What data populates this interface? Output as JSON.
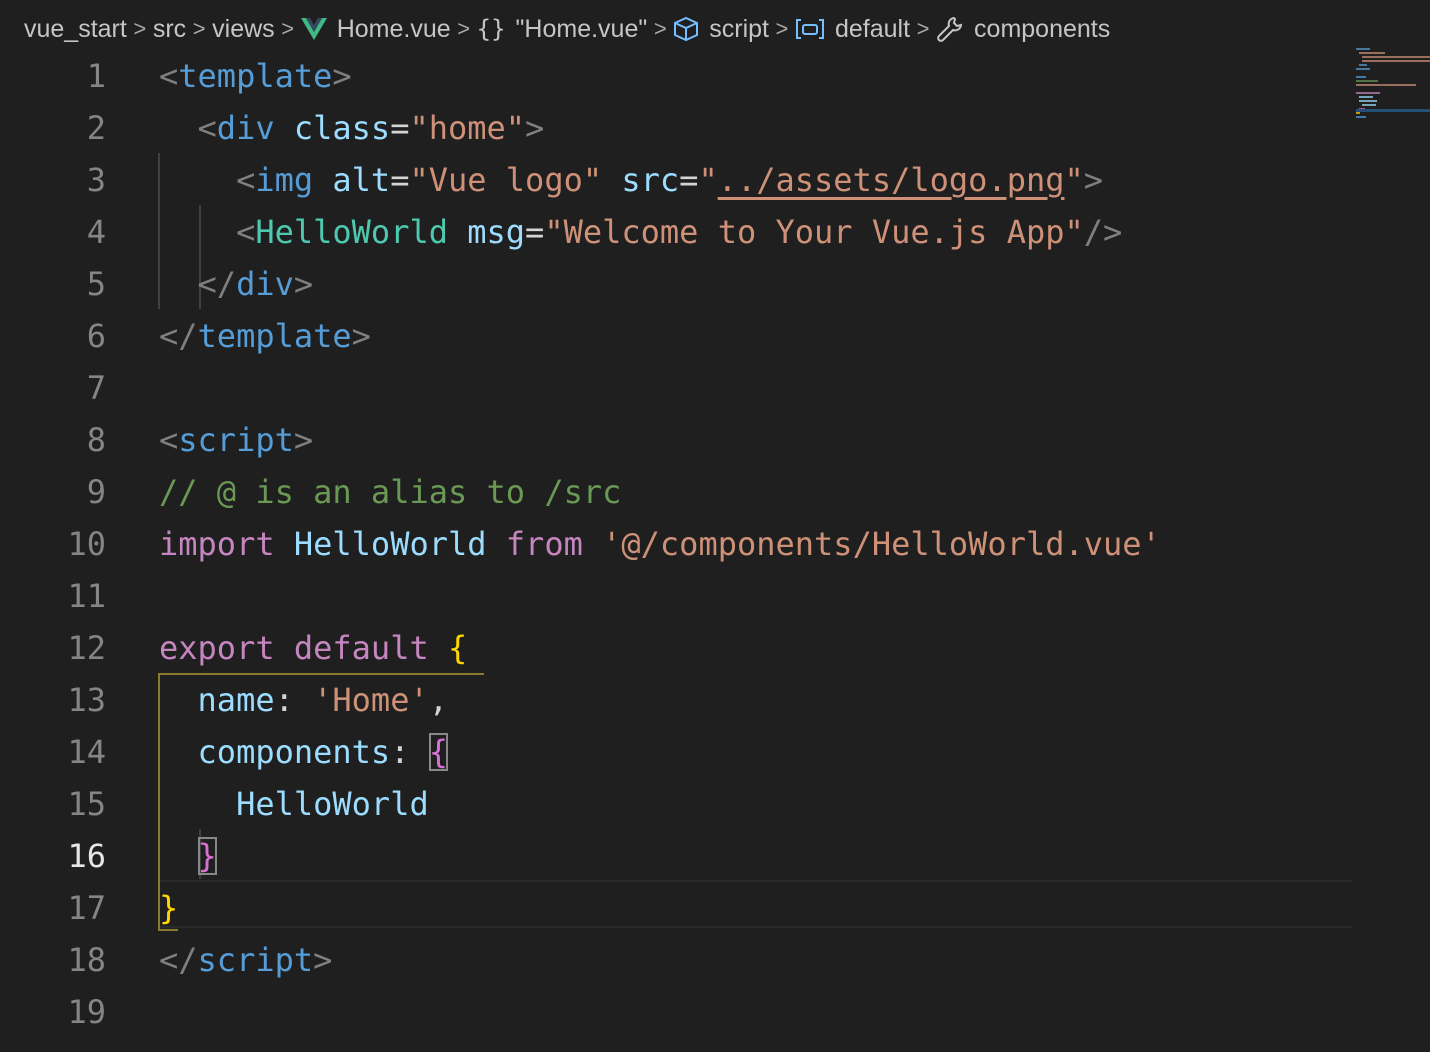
{
  "breadcrumb": {
    "items": [
      {
        "label": "vue_start",
        "icon": ""
      },
      {
        "label": "src",
        "icon": ""
      },
      {
        "label": "views",
        "icon": ""
      },
      {
        "label": "Home.vue",
        "icon": "vue-logo-icon"
      },
      {
        "label": "\"Home.vue\"",
        "icon": "braces-icon"
      },
      {
        "label": "script",
        "icon": "cube-icon"
      },
      {
        "label": "default",
        "icon": "variable-icon"
      },
      {
        "label": "components",
        "icon": "wrench-icon"
      }
    ],
    "separator": ">"
  },
  "editor": {
    "active_line": 16,
    "lines": [
      {
        "n": "1",
        "tokens": [
          [
            "punct",
            "<"
          ],
          [
            "tag",
            "template"
          ],
          [
            "punct",
            ">"
          ]
        ]
      },
      {
        "n": "2",
        "tokens": [
          [
            "text",
            "  "
          ],
          [
            "punct",
            "<"
          ],
          [
            "tag",
            "div"
          ],
          [
            "text",
            " "
          ],
          [
            "attr",
            "class"
          ],
          [
            "text",
            "="
          ],
          [
            "str",
            "\"home\""
          ],
          [
            "punct",
            ">"
          ]
        ]
      },
      {
        "n": "3",
        "tokens": [
          [
            "text",
            "    "
          ],
          [
            "punct",
            "<"
          ],
          [
            "tag",
            "img"
          ],
          [
            "text",
            " "
          ],
          [
            "attr",
            "alt"
          ],
          [
            "text",
            "="
          ],
          [
            "str",
            "\"Vue logo\""
          ],
          [
            "text",
            " "
          ],
          [
            "attr",
            "src"
          ],
          [
            "text",
            "="
          ],
          [
            "str",
            "\""
          ],
          [
            "strul",
            "../assets/logo.png"
          ],
          [
            "str",
            "\""
          ],
          [
            "punct",
            ">"
          ]
        ]
      },
      {
        "n": "4",
        "tokens": [
          [
            "text",
            "    "
          ],
          [
            "punct",
            "<"
          ],
          [
            "tag2",
            "HelloWorld"
          ],
          [
            "text",
            " "
          ],
          [
            "attr",
            "msg"
          ],
          [
            "text",
            "="
          ],
          [
            "str",
            "\"Welcome to Your Vue.js App\""
          ],
          [
            "punct",
            "/>"
          ]
        ]
      },
      {
        "n": "5",
        "tokens": [
          [
            "text",
            "  "
          ],
          [
            "punct",
            "</"
          ],
          [
            "tag",
            "div"
          ],
          [
            "punct",
            ">"
          ]
        ]
      },
      {
        "n": "6",
        "tokens": [
          [
            "punct",
            "</"
          ],
          [
            "tag",
            "template"
          ],
          [
            "punct",
            ">"
          ]
        ]
      },
      {
        "n": "7",
        "tokens": []
      },
      {
        "n": "8",
        "tokens": [
          [
            "punct",
            "<"
          ],
          [
            "tag",
            "script"
          ],
          [
            "punct",
            ">"
          ]
        ]
      },
      {
        "n": "9",
        "tokens": [
          [
            "comment",
            "// @ is an alias to /src"
          ]
        ]
      },
      {
        "n": "10",
        "tokens": [
          [
            "kw",
            "import"
          ],
          [
            "text",
            " "
          ],
          [
            "var",
            "HelloWorld"
          ],
          [
            "text",
            " "
          ],
          [
            "kw",
            "from"
          ],
          [
            "text",
            " "
          ],
          [
            "str",
            "'@/components/HelloWorld.vue'"
          ]
        ]
      },
      {
        "n": "11",
        "tokens": []
      },
      {
        "n": "12",
        "tokens": [
          [
            "kw",
            "export"
          ],
          [
            "text",
            " "
          ],
          [
            "kw",
            "default"
          ],
          [
            "text",
            " "
          ],
          [
            "brace1",
            "{"
          ]
        ]
      },
      {
        "n": "13",
        "tokens": [
          [
            "text",
            "  "
          ],
          [
            "var",
            "name"
          ],
          [
            "text",
            ": "
          ],
          [
            "str",
            "'Home'"
          ],
          [
            "text",
            ","
          ]
        ]
      },
      {
        "n": "14",
        "tokens": [
          [
            "text",
            "  "
          ],
          [
            "var",
            "components"
          ],
          [
            "text",
            ": "
          ],
          [
            "brace2box",
            "{"
          ]
        ]
      },
      {
        "n": "15",
        "tokens": [
          [
            "text",
            "    "
          ],
          [
            "var",
            "HelloWorld"
          ]
        ]
      },
      {
        "n": "16",
        "tokens": [
          [
            "text",
            "  "
          ],
          [
            "brace2box",
            "}"
          ]
        ]
      },
      {
        "n": "17",
        "tokens": [
          [
            "brace1",
            "}"
          ]
        ]
      },
      {
        "n": "18",
        "tokens": [
          [
            "punct",
            "</"
          ],
          [
            "tag",
            "script"
          ],
          [
            "punct",
            ">"
          ]
        ]
      },
      {
        "n": "19",
        "tokens": []
      }
    ]
  },
  "colors": {
    "background": "#1f1f1f",
    "tag": "#569cd6",
    "component_tag": "#4ec9b0",
    "attribute": "#9cdcfe",
    "string": "#ce9178",
    "keyword": "#c586c0",
    "comment": "#6a9955",
    "brace_level1": "#ffd700",
    "brace_level2": "#da70d6",
    "vue_logo": "#41b883"
  }
}
